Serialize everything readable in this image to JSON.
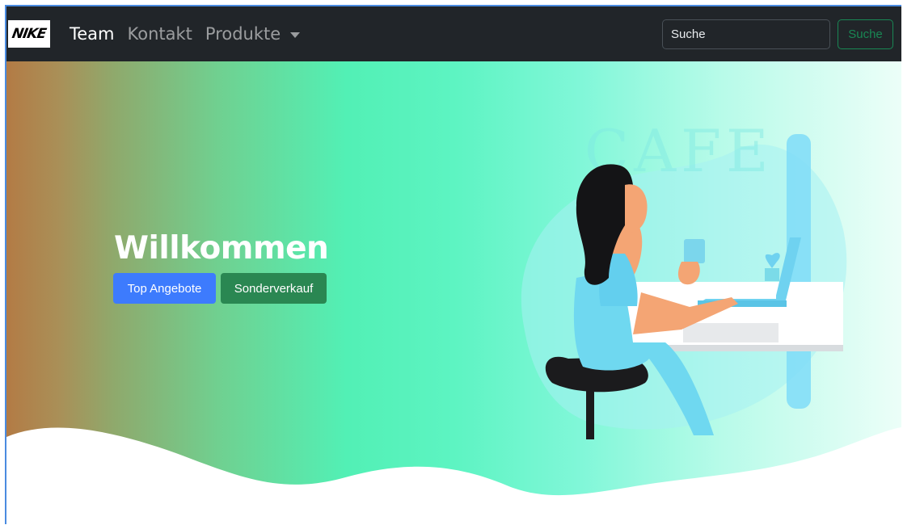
{
  "navbar": {
    "brand_text": "NIKE",
    "links": [
      {
        "label": "Team",
        "active": true
      },
      {
        "label": "Kontakt",
        "active": false
      },
      {
        "label": "Produkte",
        "active": false,
        "dropdown": true
      }
    ],
    "search": {
      "placeholder": "Suche",
      "button_label": "Suche"
    }
  },
  "hero": {
    "title": "Willkommen",
    "buttons": {
      "primary": "Top Angebote",
      "success": "Sonderverkauf"
    },
    "illustration_sign": "CAFE"
  },
  "colors": {
    "navbar_bg": "#212529",
    "primary": "#3d7bfd",
    "success": "#2a8752",
    "gradient_left": "#b37b45",
    "gradient_mid": "#52f0b5",
    "gradient_right": "#ecfef8"
  }
}
